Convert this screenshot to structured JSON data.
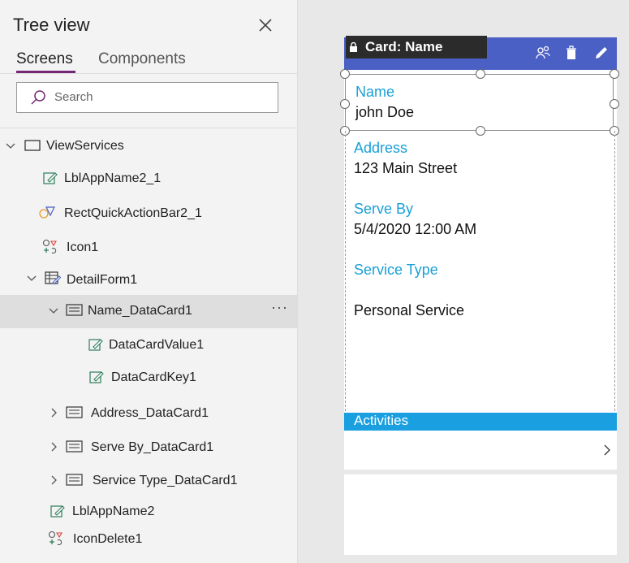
{
  "tree_panel": {
    "title": "Tree view",
    "tabs": [
      {
        "label": "Screens",
        "active": true
      },
      {
        "label": "Components",
        "active": false
      }
    ],
    "search": {
      "placeholder": "Search",
      "value": ""
    },
    "items": [
      {
        "label": "ViewServices",
        "icon": "screen-icon",
        "expanded": true
      },
      {
        "label": "LblAppName2_1",
        "icon": "edit-label-icon"
      },
      {
        "label": "RectQuickActionBar2_1",
        "icon": "shapes-icon"
      },
      {
        "label": "Icon1",
        "icon": "icon-control-icon"
      },
      {
        "label": "DetailForm1",
        "icon": "form-icon",
        "expanded": true
      },
      {
        "label": "Name_DataCard1",
        "icon": "card-icon",
        "expanded": true,
        "selected": true
      },
      {
        "label": "DataCardValue1",
        "icon": "edit-label-icon"
      },
      {
        "label": "DataCardKey1",
        "icon": "edit-label-icon"
      },
      {
        "label": "Address_DataCard1",
        "icon": "card-icon",
        "expanded": false
      },
      {
        "label": "Serve By_DataCard1",
        "icon": "card-icon",
        "expanded": false
      },
      {
        "label": "Service Type_DataCard1",
        "icon": "card-icon",
        "expanded": false
      },
      {
        "label": "LblAppName2",
        "icon": "edit-label-icon"
      },
      {
        "label": "IconDelete1",
        "icon": "icon-control-icon"
      }
    ],
    "more_label": "···"
  },
  "canvas": {
    "badge": "Card: Name",
    "toolbar_icons": [
      "people-icon",
      "trash-icon",
      "pencil-icon"
    ],
    "fields": [
      {
        "label": "Name",
        "value": "john Doe"
      },
      {
        "label": "Address",
        "value": "123 Main Street"
      },
      {
        "label": "Serve By",
        "value": "5/4/2020 12:00 AM"
      },
      {
        "label": "Service Type",
        "value": "Personal Service"
      }
    ],
    "activities_label": "Activities"
  },
  "colors": {
    "accent": "#742774",
    "toolbar": "#4a60c5",
    "label_blue": "#1aa0d8",
    "activities_bar": "#1aa0e0"
  }
}
